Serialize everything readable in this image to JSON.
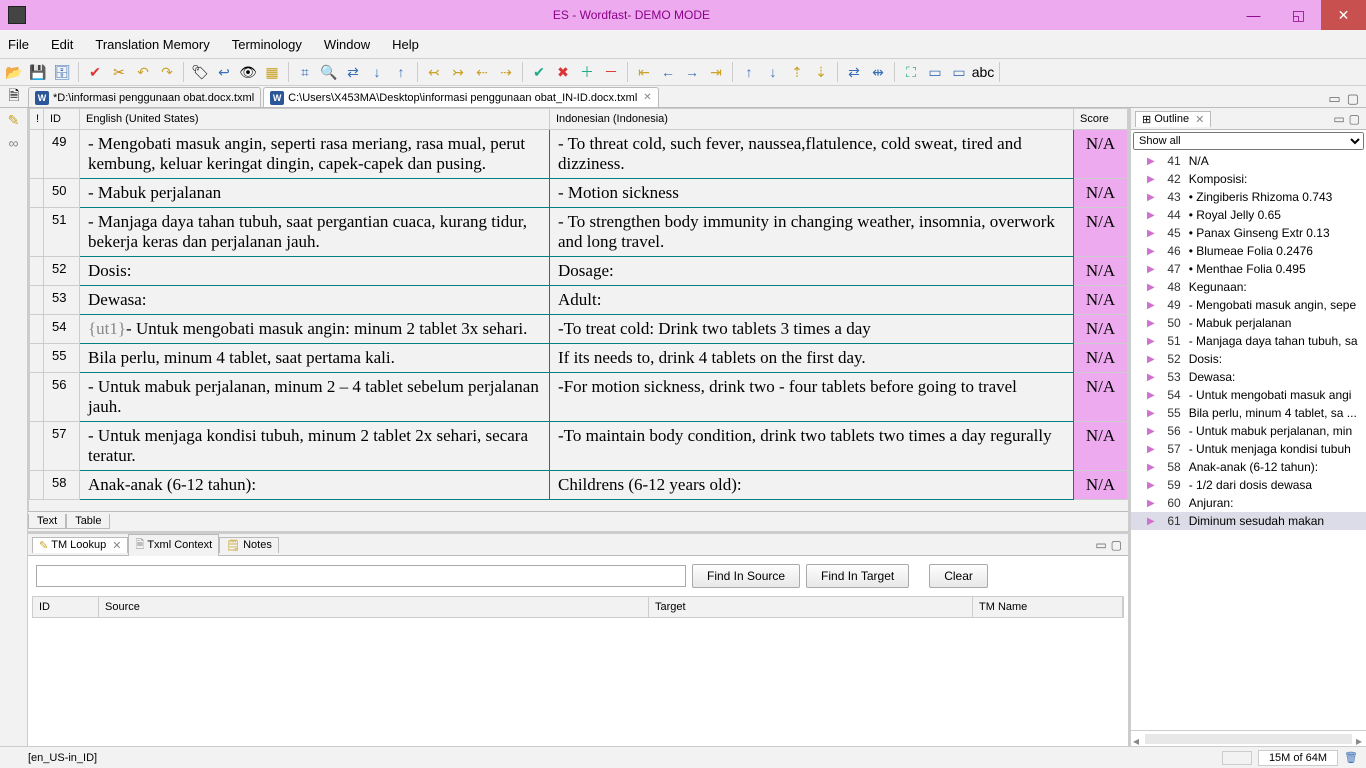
{
  "window": {
    "title": "ES - Wordfast- DEMO MODE"
  },
  "menu": [
    "File",
    "Edit",
    "Translation Memory",
    "Terminology",
    "Window",
    "Help"
  ],
  "tabs": [
    {
      "label": "*D:\\informasi penggunaan obat.docx.txml",
      "active": false
    },
    {
      "label": "C:\\Users\\X453MA\\Desktop\\informasi penggunaan obat_IN-ID.docx.txml",
      "active": true
    }
  ],
  "columns": {
    "flag": "!",
    "id": "ID",
    "source": "English (United States)",
    "target": "Indonesian (Indonesia)",
    "score": "Score"
  },
  "segments": [
    {
      "id": "49",
      "source": "- Mengobati masuk angin, seperti rasa meriang, rasa mual, perut kembung, keluar keringat dingin, capek-capek dan pusing.",
      "target": "- To threat cold, such fever, naussea,flatulence, cold sweat, tired and dizziness.",
      "score": "N/A"
    },
    {
      "id": "50",
      "source": "- Mabuk perjalanan",
      "target": "- Motion sickness",
      "score": "N/A"
    },
    {
      "id": "51",
      "source": "- Manjaga daya tahan tubuh, saat pergantian cuaca, kurang tidur, bekerja keras dan perjalanan jauh.",
      "target": "- To strengthen body immunity in changing weather, insomnia, overwork and long travel.",
      "score": "N/A"
    },
    {
      "id": "52",
      "source": "Dosis:",
      "target": "Dosage:",
      "score": "N/A"
    },
    {
      "id": "53",
      "source": "Dewasa:",
      "target": "Adult:",
      "score": "N/A"
    },
    {
      "id": "54",
      "source_prefix": "{ut1}",
      "source": "- Untuk mengobati masuk angin: minum 2 tablet 3x sehari.",
      "target": "-To treat cold: Drink two tablets 3 times a day",
      "score": "N/A"
    },
    {
      "id": "55",
      "source": "Bila perlu, minum 4 tablet, saat pertama kali.",
      "target": "If its needs to, drink 4 tablets on the first day.",
      "score": "N/A"
    },
    {
      "id": "56",
      "source": "- Untuk mabuk perjalanan, minum 2 – 4 tablet sebelum perjalanan jauh.",
      "target": "-For motion sickness, drink two - four tablets before going to travel",
      "score": "N/A"
    },
    {
      "id": "57",
      "source": "- Untuk menjaga kondisi tubuh, minum 2 tablet 2x sehari, secara teratur.",
      "target": "-To maintain body condition, drink two tablets two times a day regurally",
      "score": "N/A"
    },
    {
      "id": "58",
      "source": "Anak-anak (6-12 tahun):",
      "target": "Childrens  (6-12 years old):",
      "score": "N/A"
    }
  ],
  "bottom_tabs": [
    "Text",
    "Table"
  ],
  "outline": {
    "title": "Outline",
    "filter": "Show all",
    "items": [
      {
        "n": "41",
        "t": "N/A"
      },
      {
        "n": "42",
        "t": "Komposisi:"
      },
      {
        "n": "43",
        "t": "• Zingiberis Rhizoma 0.743"
      },
      {
        "n": "44",
        "t": "• Royal Jelly 0.65"
      },
      {
        "n": "45",
        "t": "• Panax Ginseng Extr 0.13"
      },
      {
        "n": "46",
        "t": "• Blumeae Folia 0.2476"
      },
      {
        "n": "47",
        "t": "• Menthae Folia 0.495"
      },
      {
        "n": "48",
        "t": "Kegunaan:"
      },
      {
        "n": "49",
        "t": "- Mengobati masuk angin, sepe"
      },
      {
        "n": "50",
        "t": "- Mabuk perjalanan"
      },
      {
        "n": "51",
        "t": "- Manjaga daya tahan tubuh, sa"
      },
      {
        "n": "52",
        "t": "Dosis:"
      },
      {
        "n": "53",
        "t": "Dewasa:"
      },
      {
        "n": "54",
        "t": "- Untuk mengobati masuk angi"
      },
      {
        "n": "55",
        "t": "Bila perlu, minum 4 tablet, sa ..."
      },
      {
        "n": "56",
        "t": "- Untuk mabuk perjalanan, min"
      },
      {
        "n": "57",
        "t": "- Untuk menjaga kondisi tubuh"
      },
      {
        "n": "58",
        "t": "Anak-anak (6-12 tahun):"
      },
      {
        "n": "59",
        "t": "- 1/2 dari dosis dewasa"
      },
      {
        "n": "60",
        "t": "Anjuran:"
      },
      {
        "n": "61",
        "t": "Diminum sesudah makan",
        "sel": true
      }
    ]
  },
  "lower_tabs": [
    "TM Lookup",
    "Txml Context",
    "Notes"
  ],
  "tm_buttons": {
    "find_source": "Find In Source",
    "find_target": "Find In Target",
    "clear": "Clear"
  },
  "tm_columns": {
    "id": "ID",
    "source": "Source",
    "target": "Target",
    "tmname": "TM Name"
  },
  "status": {
    "locale": "[en_US-in_ID]",
    "mem": "15M of 64M"
  }
}
